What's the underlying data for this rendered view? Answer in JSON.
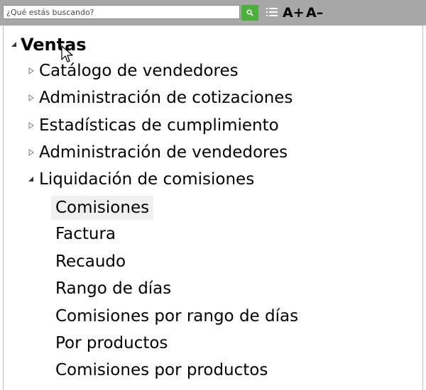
{
  "toolbar": {
    "search_placeholder": "¿Qué estás buscando?",
    "font_increase_label": "A+",
    "font_decrease_label": "A–"
  },
  "tree": {
    "root": "Ventas",
    "categories": [
      "Catálogo de vendedores",
      "Administración de cotizaciones",
      "Estadísticas de cumplimiento",
      "Administración de vendedores",
      "Liquidación de comisiones"
    ],
    "leaves": [
      "Comisiones",
      "Factura",
      "Recaudo",
      "Rango de días",
      "Comisiones por rango de días",
      "Por productos",
      "Comisiones por productos"
    ],
    "selected_leaf": "Comisiones"
  },
  "colors": {
    "toolbar_bg": "#a7a7a7",
    "search_button": "#4cae3d",
    "selected_row_bg": "#f0f0f0"
  }
}
